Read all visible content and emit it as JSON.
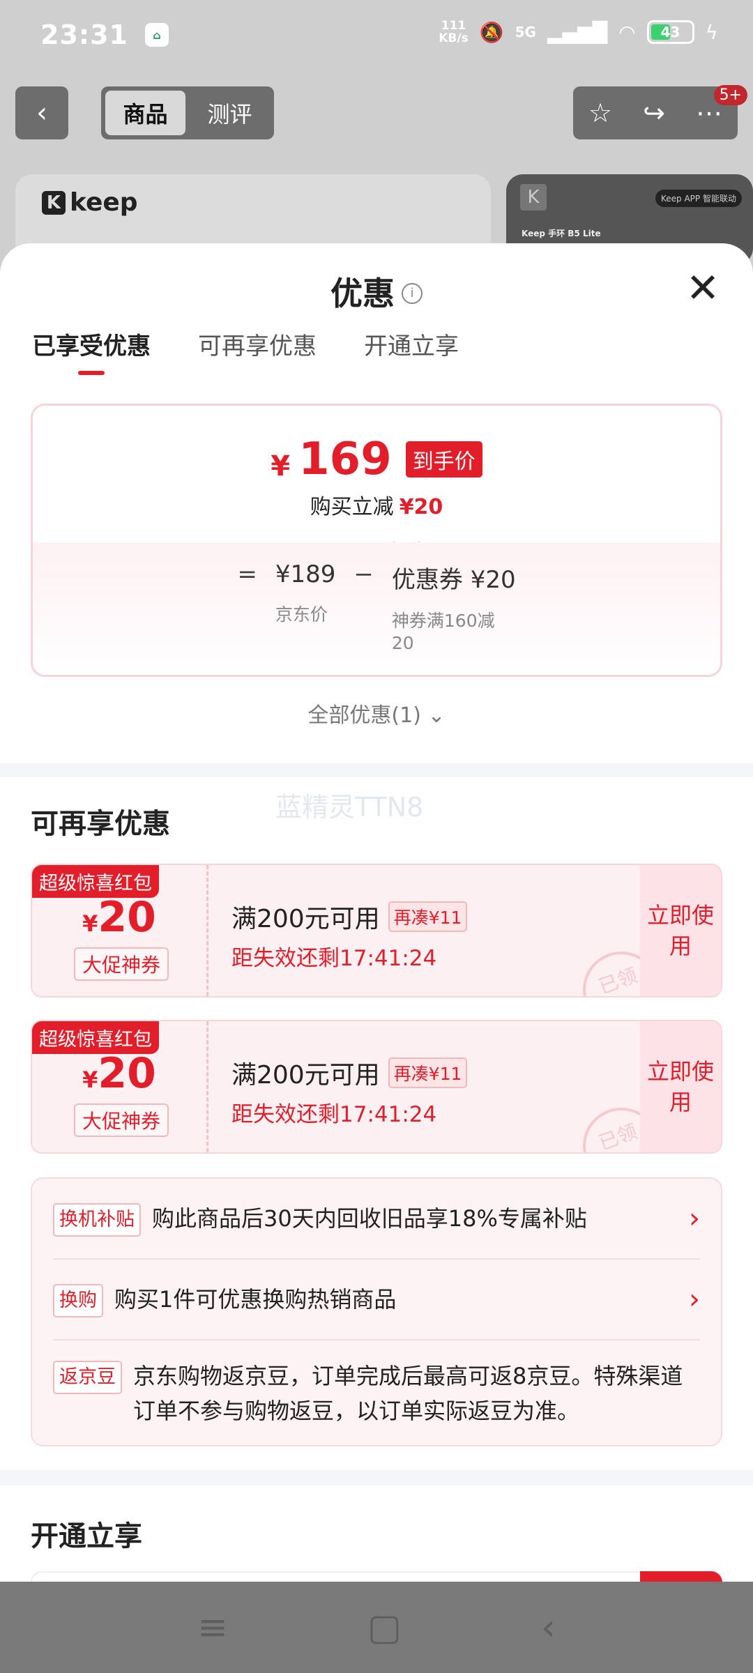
{
  "status_bar": {
    "time": "23:31",
    "net_speed_value": "111",
    "net_speed_unit": "KB/s",
    "network": "5G",
    "battery": "43"
  },
  "background": {
    "tabs": [
      "商品",
      "测评"
    ],
    "badge": "5+",
    "brand": "keep",
    "right_tag": "Keep APP 智能联动",
    "right_title": "Keep 手环 B5 Lite"
  },
  "sheet": {
    "title": "优惠",
    "tabs": [
      "已享受优惠",
      "可再享优惠",
      "开通立享"
    ],
    "price": {
      "currency": "¥",
      "final": "169",
      "final_tag": "到手价",
      "reduce_label": "购买立减",
      "reduce_amount": "¥20",
      "eq": "=",
      "minus": "−",
      "original": "¥189",
      "original_label": "京东价",
      "coupon_label": "优惠券 ¥20",
      "coupon_desc": "神券满160减20"
    },
    "all_discounts": "全部优惠(1)",
    "watermark": "蓝精灵TTN8",
    "section_more": "可再享优惠",
    "coupons": [
      {
        "badge": "超级惊喜红包",
        "currency": "¥",
        "amount": "20",
        "type": "大促神券",
        "condition": "满200元可用",
        "tag": "再凑¥11",
        "expire": "距失效还剩17:41:24",
        "action": "立即使用",
        "stamp": "已领"
      },
      {
        "badge": "超级惊喜红包",
        "currency": "¥",
        "amount": "20",
        "type": "大促神券",
        "condition": "满200元可用",
        "tag": "再凑¥11",
        "expire": "距失效还剩17:41:24",
        "action": "立即使用",
        "stamp": "已领"
      }
    ],
    "perks": [
      {
        "tag": "换机补贴",
        "text": "购此商品后30天内回收旧品享18%专属补贴"
      },
      {
        "tag": "换购",
        "text": "购买1件可优惠换购热销商品"
      },
      {
        "tag": "返京豆",
        "text": "京东购物返京豆，订单完成后最高可返8京豆。特殊渠道订单不参与购物返豆，以订单实际返豆为准。"
      }
    ],
    "section_open": "开通立享"
  }
}
